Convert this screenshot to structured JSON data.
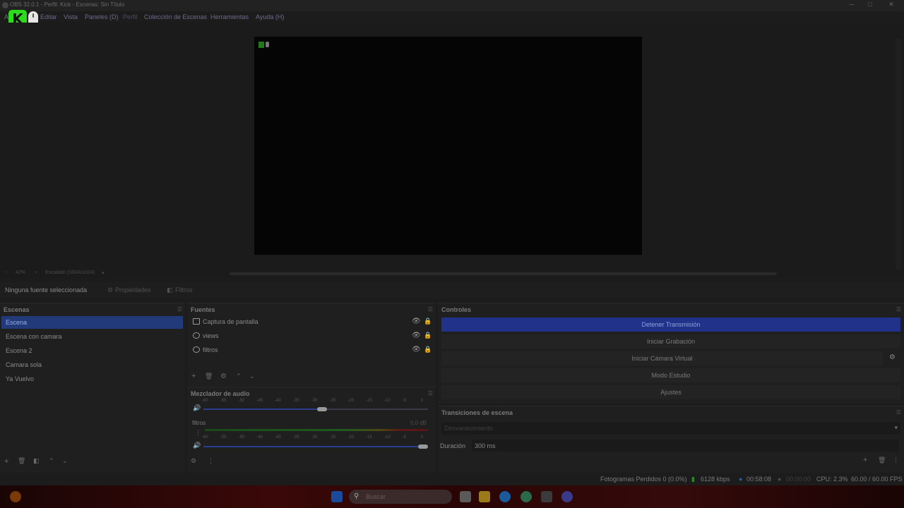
{
  "window": {
    "title": "OBS 32.0.1 - Perfil: Kick - Escenas: Sin Título",
    "minimize": "─",
    "maximize": "□",
    "close": "✕"
  },
  "menu": {
    "items": [
      "Archivo",
      "Editar",
      "Vista",
      "Paneles (D)",
      "Perfil",
      "Colección de Escenas",
      "Herramientas",
      "Ayuda (H)"
    ]
  },
  "preview": {
    "zoom_minus": "−",
    "zoom": "42%",
    "zoom_plus": "+",
    "scale": "Escalado (1824x1024)"
  },
  "context": {
    "no_source": "Ninguna fuente seleccionada",
    "properties": "Propiedades",
    "filters": "Filtros"
  },
  "scenes": {
    "title": "Escenas",
    "items": [
      "Escena",
      "Escena con camara",
      "Escena 2",
      "Camara sola",
      "Ya Vuelvo"
    ]
  },
  "sources": {
    "title": "Fuentes",
    "items": [
      {
        "label": "Captura de pantalla",
        "icon": "monitor-icon"
      },
      {
        "label": "views",
        "icon": "globe-icon"
      },
      {
        "label": "filtros",
        "icon": "globe-icon"
      }
    ]
  },
  "mixer": {
    "title": "Mezclador de audio",
    "ticks": [
      "-60",
      "-55",
      "-50",
      "-45",
      "-40",
      "-35",
      "-30",
      "-25",
      "-20",
      "-15",
      "-10",
      "-5",
      "0"
    ],
    "track2_name": "filtros",
    "track2_db": "0.0 dB",
    "track1_volume": 0.55,
    "track2_volume": 1.0
  },
  "controls": {
    "title": "Controles",
    "stop_stream": "Detener Transmisión",
    "start_record": "Iniciar Grabación",
    "start_virtualcam": "Iniciar Cámara Virtual",
    "studio_mode": "Modo Estudio",
    "settings": "Ajustes"
  },
  "transitions": {
    "title": "Transiciones de escena",
    "selected": "Desvanecimiento",
    "duration_label": "Duración",
    "duration_value": "300 ms"
  },
  "status": {
    "dropped": "Fotogramas Perdidos 0 (0.0%)",
    "bitrate": "6128 kbps",
    "stream_time": "00:58:08",
    "record_time": "00:00:00",
    "cpu": "CPU: 2.3%",
    "fps": "60.00 / 60.00 FPS"
  },
  "taskbar": {
    "search_placeholder": "Buscar"
  },
  "colors": {
    "accent": "#223a7a",
    "kick_green": "#2bdc1a"
  }
}
